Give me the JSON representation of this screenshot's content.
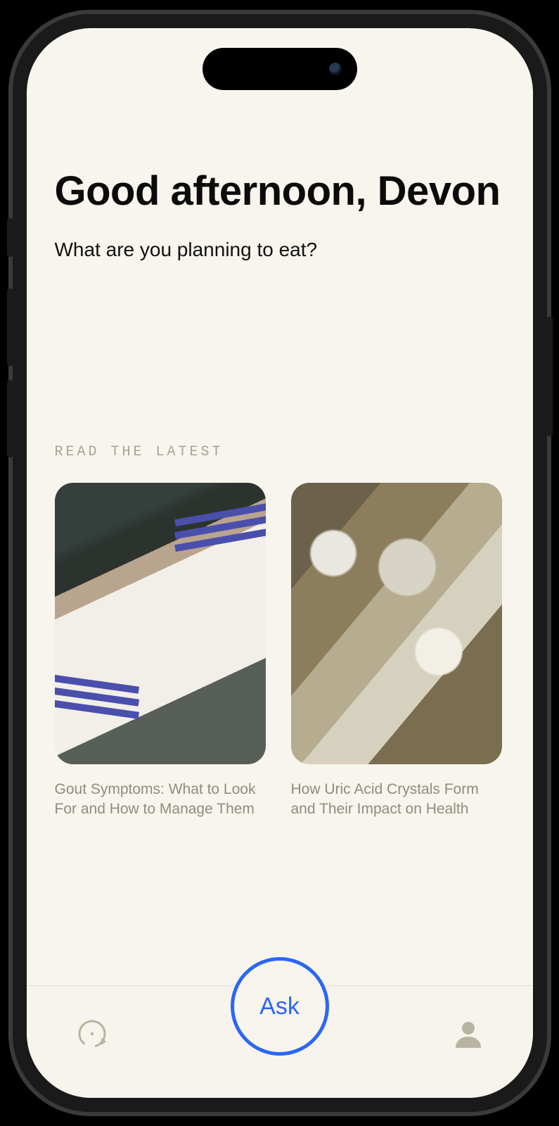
{
  "header": {
    "greeting": "Good afternoon, Devon",
    "subtitle": "What are you planning to eat?"
  },
  "latest": {
    "section_label": "READ THE LATEST",
    "articles": [
      {
        "title": "Gout Symptoms: What to Look For and How to Manage Them",
        "image": "socks"
      },
      {
        "title": "How Uric Acid Crystals Form and Their Impact on Health",
        "image": "crystals"
      }
    ]
  },
  "tabbar": {
    "ask_label": "Ask",
    "left_icon": "timer-icon",
    "right_icon": "profile-icon"
  },
  "accent_color": "#2b66f6"
}
